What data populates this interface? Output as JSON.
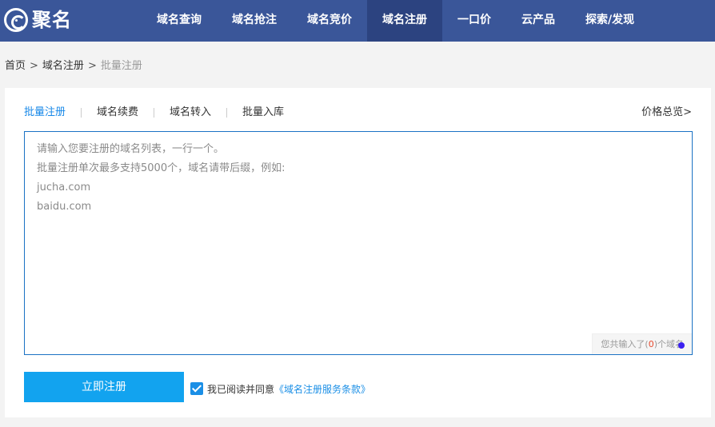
{
  "brand": {
    "name": "聚名"
  },
  "nav": {
    "items": [
      {
        "label": "域名查询"
      },
      {
        "label": "域名抢注"
      },
      {
        "label": "域名竞价"
      },
      {
        "label": "域名注册"
      },
      {
        "label": "一口价"
      },
      {
        "label": "云产品"
      },
      {
        "label": "探索/发现"
      }
    ],
    "active_index": 3
  },
  "breadcrumb": {
    "home": "首页",
    "parent": "域名注册",
    "current": "批量注册",
    "separator": ">"
  },
  "tabs": {
    "items": [
      {
        "label": "批量注册"
      },
      {
        "label": "域名续费"
      },
      {
        "label": "域名转入"
      },
      {
        "label": "批量入库"
      }
    ],
    "active_index": 0
  },
  "price_link": "价格总览>",
  "domain_input": {
    "value": "",
    "placeholder": "请输入您要注册的域名列表，一行一个。\n批量注册单次最多支持5000个，域名请带后缀，例如:\njucha.com\nbaidu.com"
  },
  "counter": {
    "prefix": "您共输入了(",
    "count": "0",
    "suffix": ")个域名"
  },
  "submit_label": "立即注册",
  "agreement": {
    "checked": true,
    "text": "我已阅读并同意",
    "link_text": "《域名注册服务条款》"
  },
  "colors": {
    "nav_bg": "#3a5699",
    "nav_active": "#2c4380",
    "accent": "#12a3ef",
    "tab_active": "#1989e8",
    "link": "#1b8fe6",
    "count": "#e64a2e"
  }
}
